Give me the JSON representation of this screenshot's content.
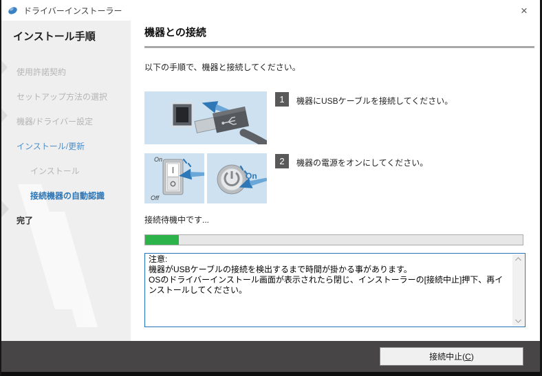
{
  "window": {
    "title": "ドライバーインストーラー",
    "close_glyph": "×"
  },
  "sidebar": {
    "header": "インストール手順",
    "items": [
      {
        "label": "使用許諾契約",
        "state": "disabled"
      },
      {
        "label": "セットアップ方法の選択",
        "state": "disabled"
      },
      {
        "label": "機器/ドライバー設定",
        "state": "disabled"
      },
      {
        "label": "インストール/更新",
        "state": "active"
      },
      {
        "label": "インストール",
        "state": "disabled"
      },
      {
        "label": "接続機器の自動認識",
        "state": "current"
      },
      {
        "label": "完了",
        "state": "upcoming"
      }
    ]
  },
  "main": {
    "heading": "機器との接続",
    "instruction": "以下の手順で、機器と接続してください。",
    "steps": [
      {
        "number": "1",
        "text": "機器にUSBケーブルを接続してください。"
      },
      {
        "number": "2",
        "text": "機器の電源をオンにしてください。"
      }
    ],
    "status_text": "接続待機中です...",
    "progress_percent": 9,
    "note_text": "注意:\n機器がUSBケーブルの接続を検出するまで時間が掛かる事があります。\nOSのドライバーインストール画面が表示されたら閉じ、インストーラーの[接続中止]押下、再インストールしてください。",
    "illustrations": {
      "usb_panel": "usb-cable-connect",
      "switch_on_label": "On",
      "switch_off_label": "Off",
      "power_on_label": "On"
    }
  },
  "footer": {
    "cancel_button": {
      "prefix": "接続中止(",
      "mnemonic": "C",
      "suffix": ")"
    }
  },
  "colors": {
    "accent_blue": "#2e75b6",
    "progress_green": "#2cb34a",
    "note_border_blue": "#2271b8",
    "illustration_bg": "#cde1f0",
    "footer_bg": "#474545",
    "sidebar_bg": "#efefef",
    "disabled_gray": "#b5b5b5"
  }
}
